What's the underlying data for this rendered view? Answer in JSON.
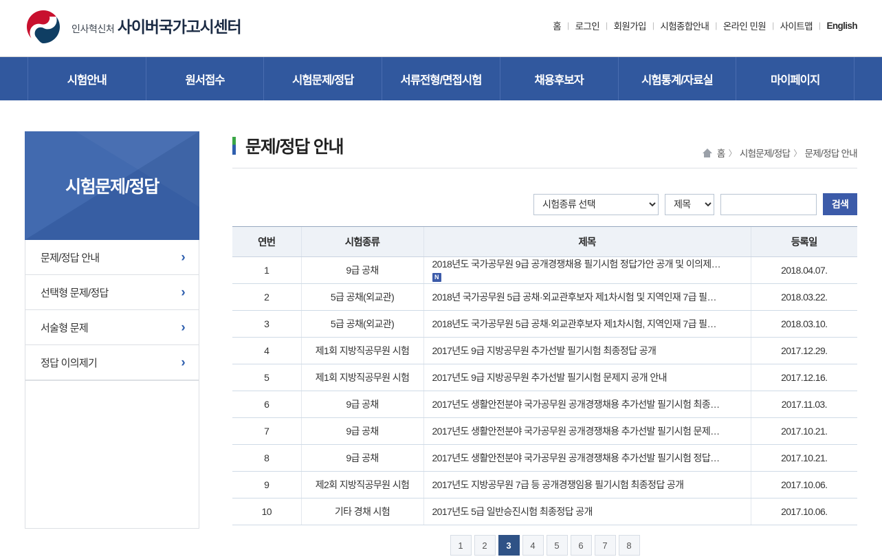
{
  "brand": {
    "agency": "인사혁신처",
    "site": "사이버국가고시센터",
    "logo_icon": "taegeuk-logo"
  },
  "util_nav": [
    {
      "label": "홈"
    },
    {
      "label": "로그인"
    },
    {
      "label": "회원가입"
    },
    {
      "label": "시험종합안내"
    },
    {
      "label": "온라인 민원"
    },
    {
      "label": "사이트맵"
    },
    {
      "label": "English"
    }
  ],
  "gnb": [
    {
      "label": "시험안내"
    },
    {
      "label": "원서접수"
    },
    {
      "label": "시험문제/정답"
    },
    {
      "label": "서류전형/면접시험"
    },
    {
      "label": "채용후보자"
    },
    {
      "label": "시험통계/자료실"
    },
    {
      "label": "마이페이지"
    }
  ],
  "sidebar": {
    "heading": "시험문제/정답",
    "items": [
      {
        "label": "문제/정답 안내",
        "icon": "chevron-right-icon"
      },
      {
        "label": "선택형 문제/정답",
        "icon": "chevron-right-icon"
      },
      {
        "label": "서술형 문제",
        "icon": "chevron-right-icon"
      },
      {
        "label": "정답 이의제기",
        "icon": "chevron-right-icon"
      }
    ]
  },
  "content": {
    "title": "문제/정답 안내",
    "breadcrumb": {
      "home_icon": "home-icon",
      "items": [
        "홈",
        "시험문제/정답",
        "문제/정답 안내"
      ],
      "separator": "〉"
    }
  },
  "search": {
    "exam_type_selected": "시험종류 선택",
    "exam_type_options": [
      "시험종류 선택"
    ],
    "field_selected": "제목",
    "field_options": [
      "제목"
    ],
    "keyword_value": "",
    "keyword_placeholder": "",
    "button_label": "검색"
  },
  "table": {
    "columns": [
      "연번",
      "시험종류",
      "제목",
      "등록일"
    ],
    "rows": [
      {
        "no": "1",
        "type": "9급 공채",
        "title": "2018년도 국가공무원 9급 공개경쟁채용 필기시험 정답가안 공개 및 이의제…",
        "badge": "N",
        "date": "2018.04.07."
      },
      {
        "no": "2",
        "type": "5급 공채(외교관)",
        "title": "2018년 국가공무원 5급 공채·외교관후보자 제1차시험 및 지역인재 7급 필…",
        "badge": "",
        "date": "2018.03.22."
      },
      {
        "no": "3",
        "type": "5급 공채(외교관)",
        "title": "2018년도 국가공무원 5급 공채·외교관후보자 제1차시험, 지역인재 7급 필…",
        "badge": "",
        "date": "2018.03.10."
      },
      {
        "no": "4",
        "type": "제1회 지방직공무원 시험",
        "title": "2017년도 9급 지방공무원 추가선발 필기시험 최종정답 공개",
        "badge": "",
        "date": "2017.12.29."
      },
      {
        "no": "5",
        "type": "제1회 지방직공무원 시험",
        "title": "2017년도 9급 지방공무원 추가선발 필기시험 문제지 공개 안내",
        "badge": "",
        "date": "2017.12.16."
      },
      {
        "no": "6",
        "type": "9급 공채",
        "title": "2017년도 생활안전분야 국가공무원 공개경쟁채용 추가선발 필기시험 최종…",
        "badge": "",
        "date": "2017.11.03."
      },
      {
        "no": "7",
        "type": "9급 공채",
        "title": "2017년도 생활안전분야 국가공무원 공개경쟁채용 추가선발 필기시험 문제…",
        "badge": "",
        "date": "2017.10.21."
      },
      {
        "no": "8",
        "type": "9급 공채",
        "title": "2017년도 생활안전분야 국가공무원 공개경쟁채용 추가선발 필기시험 정답…",
        "badge": "",
        "date": "2017.10.21."
      },
      {
        "no": "9",
        "type": "제2회 지방직공무원 시험",
        "title": "2017년도 지방공무원 7급 등 공개경쟁임용 필기시험 최종정답 공개",
        "badge": "",
        "date": "2017.10.06."
      },
      {
        "no": "10",
        "type": "기타 경채 시험",
        "title": "2017년도 5급 일반승진시험 최종정답 공개",
        "badge": "",
        "date": "2017.10.06."
      }
    ]
  },
  "pagination": {
    "pages": [
      "1",
      "2",
      "3",
      "4",
      "5",
      "6",
      "7",
      "8"
    ],
    "active": "3"
  },
  "colors": {
    "gnb_blue": "#31589e",
    "sidebar_blue": "#3a64ac",
    "button_blue": "#3c5ba9",
    "title_green": "#3aa646",
    "title_blue": "#2f5fae",
    "table_header_bg": "#eef2f7"
  }
}
